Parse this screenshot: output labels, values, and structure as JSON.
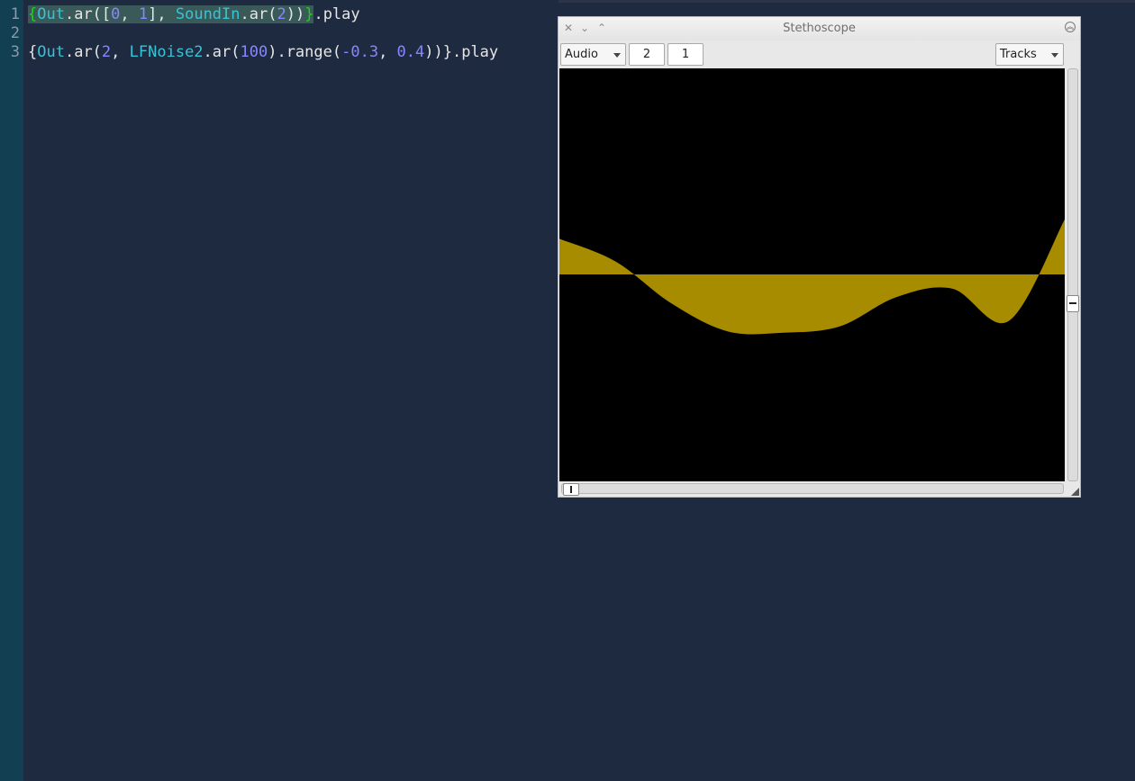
{
  "editor": {
    "line_numbers": [
      "1",
      "2",
      "3"
    ],
    "line1": {
      "t1": "{",
      "t2": "Out",
      "t3": ".ar([",
      "t4": "0",
      "t5": ", ",
      "t6": "1",
      "t7": "], ",
      "t8": "SoundIn",
      "t9": ".ar(",
      "t10": "2",
      "t11": "))",
      "t12": "}",
      "t13": ".play"
    },
    "line3": {
      "t1": "{",
      "t2": "Out",
      "t3": ".ar(",
      "t4": "2",
      "t5": ", ",
      "t6": "LFNoise2",
      "t7": ".ar(",
      "t8": "100",
      "t9": ").range(",
      "t10": "-0.3",
      "t11": ", ",
      "t12": "0.4",
      "t13": "))}.play"
    }
  },
  "scope": {
    "title": "Stethoscope",
    "rate_select": "Audio",
    "num_channels": "2",
    "channel_offset": "1",
    "style_select": "Tracks",
    "waveform_color": "#a88c00",
    "waveform_levels": [
      0.55,
      0.2,
      -0.45,
      -0.88,
      -0.9,
      -0.8,
      -0.35,
      -0.22,
      -0.72,
      0.85
    ]
  },
  "colors": {
    "editor_bg": "#1e2a40",
    "gutter_bg": "#123f52",
    "class_color": "#36c4d6",
    "number_color": "#8a86ff",
    "brace_highlight": "#22d11c"
  }
}
